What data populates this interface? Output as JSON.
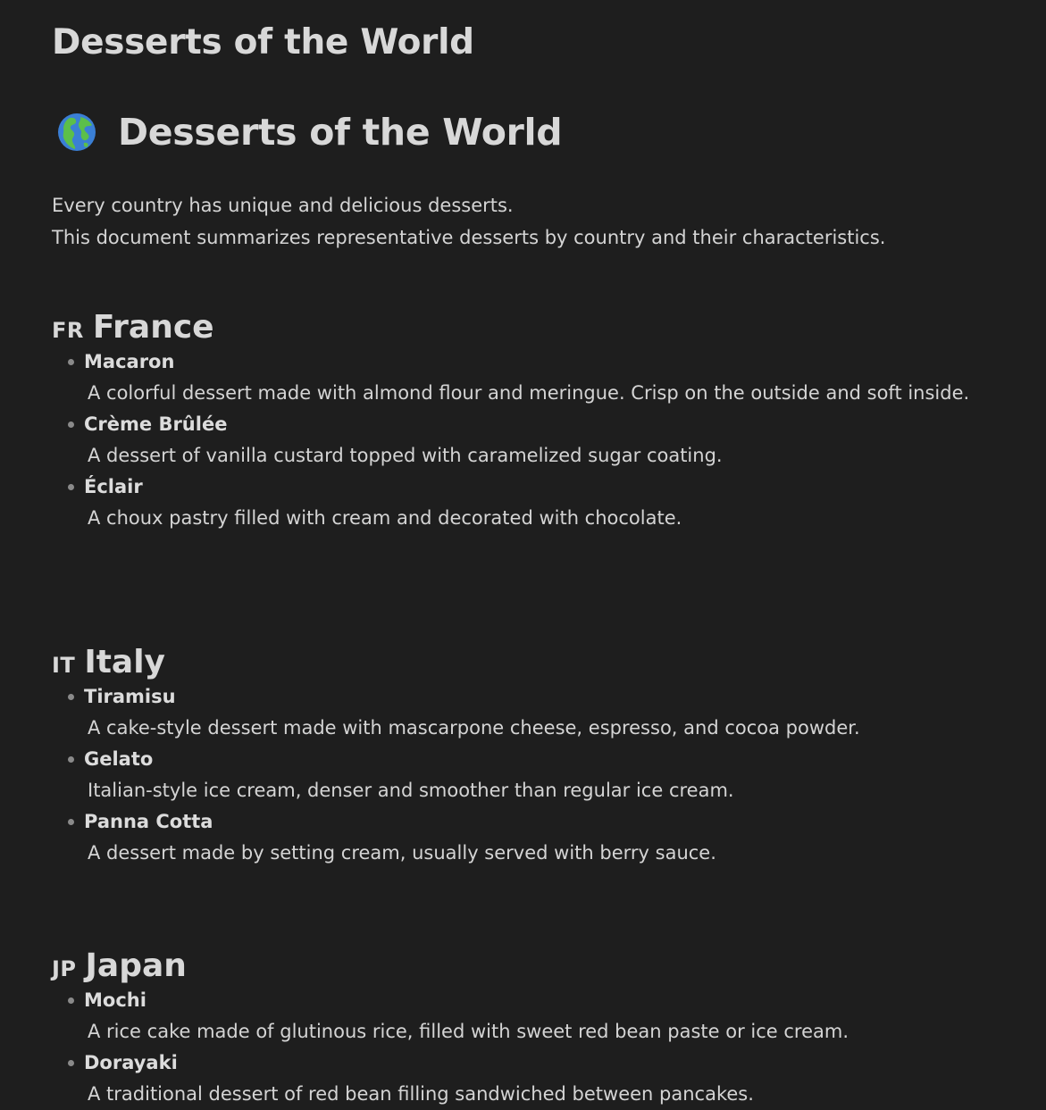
{
  "document": {
    "title": "Desserts of the World",
    "heading": "Desserts of the World",
    "heading_icon": "globe-icon",
    "intro": [
      "Every country has unique and delicious desserts.",
      "This document summarizes representative desserts by country and their characteristics."
    ]
  },
  "sections": [
    {
      "flag": "FR",
      "country": "France",
      "desserts": [
        {
          "name": "Macaron",
          "description": "A colorful dessert made with almond flour and meringue. Crisp on the outside and soft inside."
        },
        {
          "name": "Crème Brûlée",
          "description": "A dessert of vanilla custard topped with caramelized sugar coating."
        },
        {
          "name": "Éclair",
          "description": "A choux pastry filled with cream and decorated with chocolate."
        }
      ]
    },
    {
      "flag": "IT",
      "country": "Italy",
      "desserts": [
        {
          "name": "Tiramisu",
          "description": "A cake-style dessert made with mascarpone cheese, espresso, and cocoa powder."
        },
        {
          "name": "Gelato",
          "description": "Italian-style ice cream, denser and smoother than regular ice cream."
        },
        {
          "name": "Panna Cotta",
          "description": "A dessert made by setting cream, usually served with berry sauce."
        }
      ]
    },
    {
      "flag": "JP",
      "country": "Japan",
      "desserts": [
        {
          "name": "Mochi",
          "description": "A rice cake made of glutinous rice, filled with sweet red bean paste or ice cream."
        },
        {
          "name": "Dorayaki",
          "description": "A traditional dessert of red bean filling sandwiched between pancakes."
        }
      ]
    }
  ],
  "colors": {
    "background": "#1e1e1e",
    "text": "#dcdcdc",
    "bullet": "#8a8a8a"
  }
}
